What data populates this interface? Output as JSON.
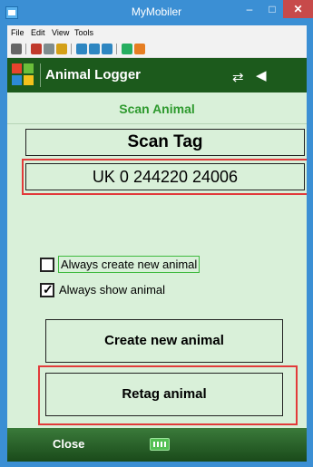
{
  "window": {
    "title": "MyMobiler",
    "min_glyph": "–",
    "max_glyph": "□",
    "close_glyph": "✕"
  },
  "menu": {
    "items": [
      {
        "label": "File"
      },
      {
        "label": "Edit"
      },
      {
        "label": "View"
      },
      {
        "label": "Tools"
      }
    ]
  },
  "app": {
    "title": "Animal Logger",
    "icons": {
      "sync": "sync-arrows-icon",
      "volume": "speaker-icon"
    },
    "sync_glyph": "⇄",
    "volume_glyph": "◀"
  },
  "screen": {
    "heading": "Scan Animal",
    "scan_tag_label": "Scan Tag",
    "tag_value": "UK 0 244220 24006",
    "checkbox_new": {
      "label": "Always create new animal",
      "checked": false
    },
    "checkbox_show": {
      "label": "Always show animal",
      "checked": true
    },
    "create_button": "Create new animal",
    "retag_button": "Retag animal"
  },
  "bottom": {
    "left_softkey": "Close",
    "center_icon": "keyboard-icon"
  },
  "colors": {
    "app_bar": "#1c5a1c",
    "content_bg": "#d9f0d9",
    "heading": "#2e9a2e",
    "highlight": "#e23a3a",
    "frame": "#3b8fd4"
  }
}
